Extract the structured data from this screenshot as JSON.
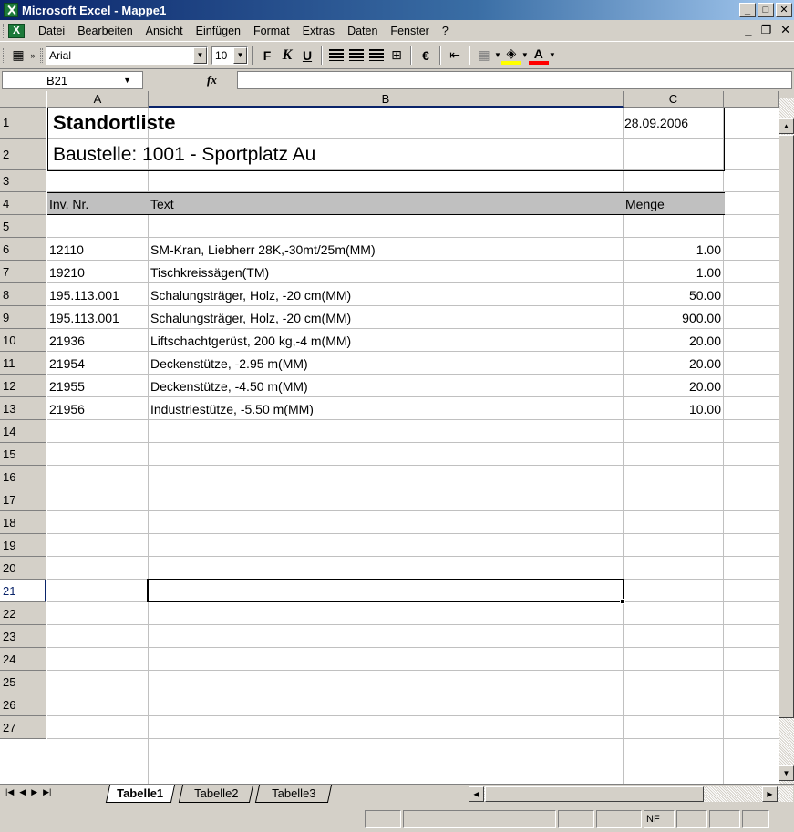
{
  "window": {
    "title": "Microsoft Excel - Mappe1"
  },
  "menu": {
    "items": [
      {
        "label": "Datei",
        "key": "D"
      },
      {
        "label": "Bearbeiten",
        "key": "B"
      },
      {
        "label": "Ansicht",
        "key": "A"
      },
      {
        "label": "Einfügen",
        "key": "E"
      },
      {
        "label": "Format",
        "key": "t"
      },
      {
        "label": "Extras",
        "key": "x"
      },
      {
        "label": "Daten",
        "key": "n"
      },
      {
        "label": "Fenster",
        "key": "F"
      },
      {
        "label": "?",
        "key": "?"
      }
    ]
  },
  "toolbar": {
    "font": "Arial",
    "size": "10",
    "bold": "F",
    "italic": "K",
    "underline": "U",
    "euro": "€",
    "font_color": "A"
  },
  "formula_bar": {
    "namebox": "B21",
    "fx": "fx",
    "formula": ""
  },
  "columns": [
    "A",
    "B",
    "C"
  ],
  "rows": [
    "1",
    "2",
    "3",
    "4",
    "5",
    "6",
    "7",
    "8",
    "9",
    "10",
    "11",
    "12",
    "13",
    "14",
    "15",
    "16",
    "17",
    "18",
    "19",
    "20",
    "21",
    "22",
    "23",
    "24",
    "25",
    "26",
    "27"
  ],
  "sheet": {
    "title": "Standortliste",
    "date": "28.09.2006",
    "subtitle": "Baustelle: 1001 - Sportplatz Au",
    "headers": {
      "inv": "Inv. Nr.",
      "text": "Text",
      "menge": "Menge"
    },
    "items": [
      {
        "inv": "12110",
        "text": "SM-Kran, Liebherr 28K,-30mt/25m(MM)",
        "menge": "1.00"
      },
      {
        "inv": "19210",
        "text": "Tischkreissägen(TM)",
        "menge": "1.00"
      },
      {
        "inv": "195.113.001",
        "text": "Schalungsträger, Holz, -20 cm(MM)",
        "menge": "50.00"
      },
      {
        "inv": "195.113.001",
        "text": "Schalungsträger, Holz, -20 cm(MM)",
        "menge": "900.00"
      },
      {
        "inv": "21936",
        "text": "Liftschachtgerüst, 200 kg,-4 m(MM)",
        "menge": "20.00"
      },
      {
        "inv": "21954",
        "text": "Deckenstütze, -2.95 m(MM)",
        "menge": "20.00"
      },
      {
        "inv": "21955",
        "text": "Deckenstütze, -4.50 m(MM)",
        "menge": "20.00"
      },
      {
        "inv": "21956",
        "text": "Industriestütze, -5.50 m(MM)",
        "menge": "10.00"
      }
    ]
  },
  "tabs": [
    "Tabelle1",
    "Tabelle2",
    "Tabelle3"
  ],
  "status": {
    "nf": "NF"
  }
}
